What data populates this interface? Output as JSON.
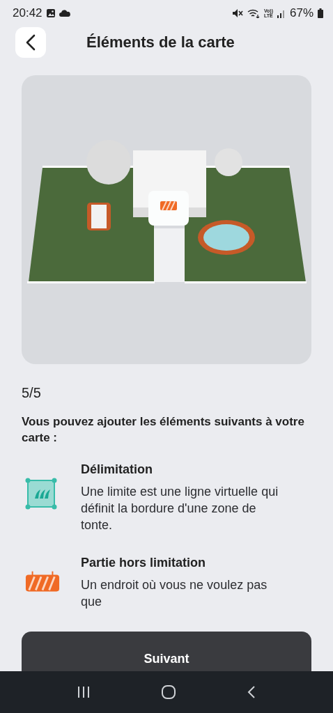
{
  "status_bar": {
    "time": "20:42",
    "volte_top": "Vo))",
    "volte_bottom": "LTE",
    "battery": "67%"
  },
  "header": {
    "title": "Éléments de la carte"
  },
  "step": "5/5",
  "intro": "Vous pouvez ajouter les éléments suivants à votre carte :",
  "elements": [
    {
      "kind": "boundary",
      "title": "Délimitation",
      "description": "Une limite est une ligne virtuelle qui définit la bordure d'une zone de tonte."
    },
    {
      "kind": "no-go",
      "title": "Partie hors limitation",
      "description": "Un endroit où vous ne voulez pas que"
    }
  ],
  "next_button": "Suivant"
}
